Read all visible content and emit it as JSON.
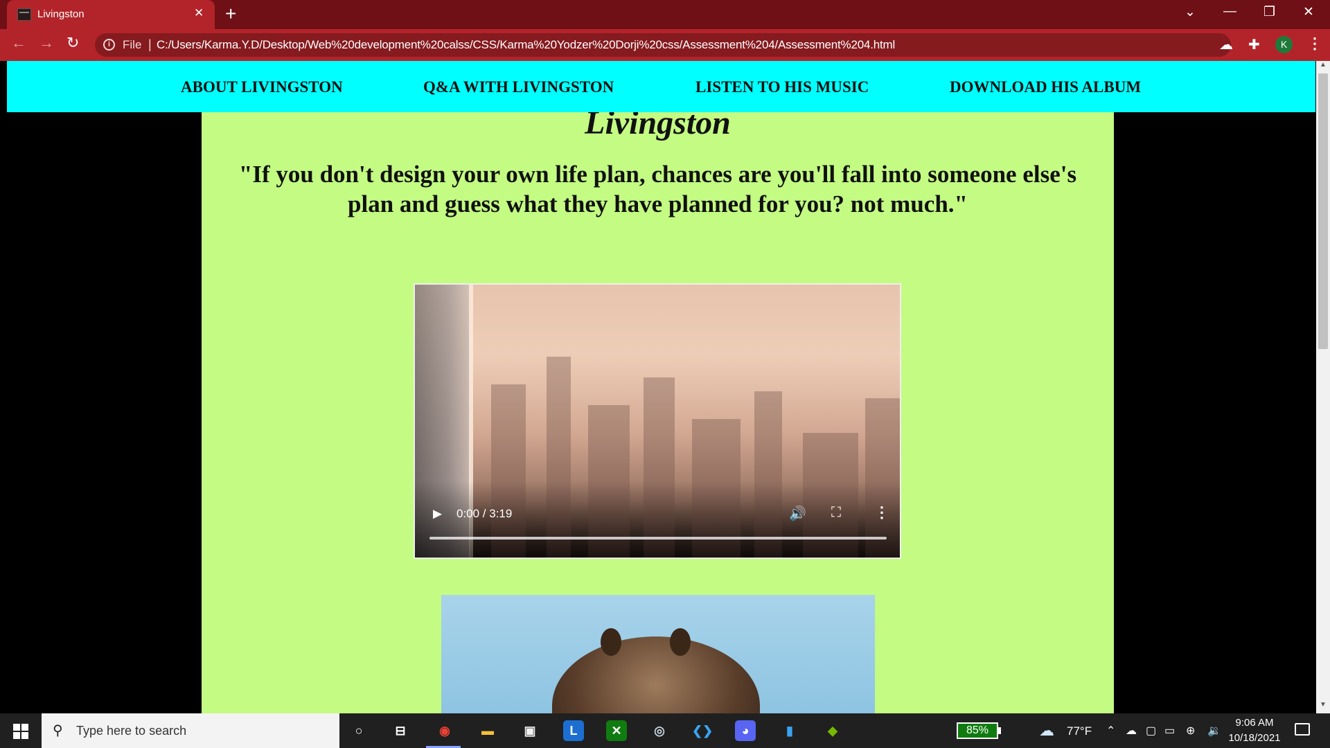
{
  "browser": {
    "tab_title": "Livingston",
    "tab_close": "✕",
    "new_tab": "+",
    "back": "←",
    "forward": "→",
    "reload": "↻",
    "info": "i",
    "file_label": "File",
    "url_separator": "|",
    "url": "C:/Users/Karma.Y.D/Desktop/Web%20development%20calss/CSS/Karma%20Yodzer%20Dorji%20css/Assessment%204/Assessment%204.html",
    "bookmark": "☆",
    "profile_initial": "K",
    "menu": "⋮",
    "window_controls": {
      "tab_search": "⌄",
      "minimize": "—",
      "restore": "❐",
      "close": "✕"
    }
  },
  "page": {
    "nav": [
      {
        "label": "ABOUT LIVINGSTON"
      },
      {
        "label": "Q&A WITH LIVINGSTON"
      },
      {
        "label": "LISTEN TO HIS MUSIC"
      },
      {
        "label": "DOWNLOAD HIS ALBUM"
      }
    ],
    "heading": "Livingston",
    "quote": "\"If you don't design your own life plan, chances are you'll fall into someone else's plan and guess what they have planned for you? not much.\"",
    "video": {
      "time": "0:00 / 3:19",
      "play": "▶",
      "volume": "🔊",
      "fullscreen": "⛶",
      "more": "⋮",
      "progress": 0
    }
  },
  "taskbar": {
    "search_placeholder": "Type here to search",
    "search_glyph": "⚲",
    "battery": "85%",
    "weather_icon": "☁",
    "temperature": "77°F",
    "time": "9:06 AM",
    "date": "10/18/2021",
    "apps": [
      {
        "name": "cortana",
        "glyph": "○",
        "color": "#202020",
        "fg": "#ffffff"
      },
      {
        "name": "task-view",
        "glyph": "⊟",
        "color": "#202020",
        "fg": "#ffffff"
      },
      {
        "name": "chrome",
        "glyph": "◉",
        "color": "#202020",
        "fg": "#e94235"
      },
      {
        "name": "file-explorer",
        "glyph": "▬",
        "color": "#202020",
        "fg": "#f3c13a"
      },
      {
        "name": "store",
        "glyph": "▣",
        "color": "#202020",
        "fg": "#f2f2f2"
      },
      {
        "name": "launcher",
        "glyph": "L",
        "color": "#1c6fd1",
        "fg": "#ffffff"
      },
      {
        "name": "xbox",
        "glyph": "✕",
        "color": "#107c10",
        "fg": "#ffffff"
      },
      {
        "name": "steam",
        "glyph": "◎",
        "color": "#202020",
        "fg": "#c7d5e0"
      },
      {
        "name": "vscode",
        "glyph": "❮❯",
        "color": "#202020",
        "fg": "#3aa3f0"
      },
      {
        "name": "discord",
        "glyph": "◕",
        "color": "#5865f2",
        "fg": "#ffffff"
      },
      {
        "name": "phone",
        "glyph": "▮",
        "color": "#202020",
        "fg": "#3aa3f0"
      },
      {
        "name": "nvidia",
        "glyph": "◆",
        "color": "#202020",
        "fg": "#76b900"
      }
    ],
    "tray": [
      {
        "name": "chevron-up",
        "glyph": "⌃"
      },
      {
        "name": "onedrive",
        "glyph": "☁"
      },
      {
        "name": "meet",
        "glyph": "▢"
      },
      {
        "name": "battery",
        "glyph": "▭"
      },
      {
        "name": "network",
        "glyph": "⊕"
      },
      {
        "name": "volume",
        "glyph": "🔉"
      }
    ]
  }
}
